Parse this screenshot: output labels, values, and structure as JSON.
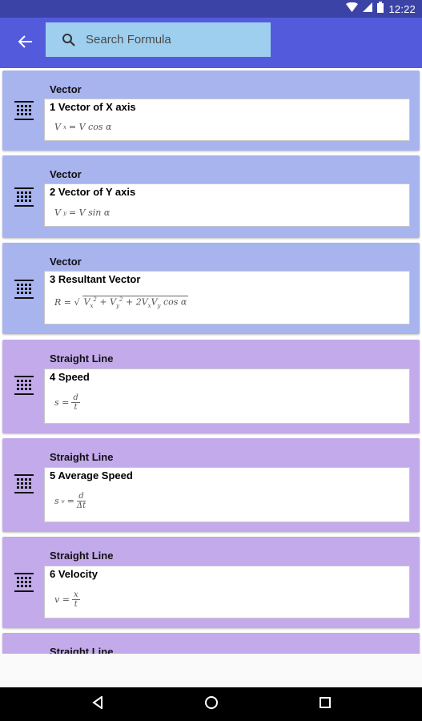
{
  "status_bar": {
    "time": "12:22"
  },
  "search": {
    "placeholder": "Search Formula"
  },
  "items": [
    {
      "category": "Vector",
      "title": "1 Vector of X axis"
    },
    {
      "category": "Vector",
      "title": "2 Vector of Y axis"
    },
    {
      "category": "Vector",
      "title": "3 Resultant Vector"
    },
    {
      "category": "Straight Line",
      "title": "4 Speed"
    },
    {
      "category": "Straight Line",
      "title": "5 Average Speed"
    },
    {
      "category": "Straight Line",
      "title": "6 Velocity"
    },
    {
      "category": "Straight Line",
      "title": ""
    }
  ],
  "colors": {
    "status_bar": "#3b43a7",
    "app_bar": "#535bdc",
    "search_field": "#9fcfef",
    "vector_card": "#a8b4ee",
    "straight_line_card": "#c3aaea"
  },
  "icons": {
    "back": "arrow-left-icon",
    "search": "search-icon",
    "item": "grid-list-icon",
    "nav_back": "triangle-back-icon",
    "nav_home": "circle-home-icon",
    "nav_recents": "square-recents-icon"
  }
}
